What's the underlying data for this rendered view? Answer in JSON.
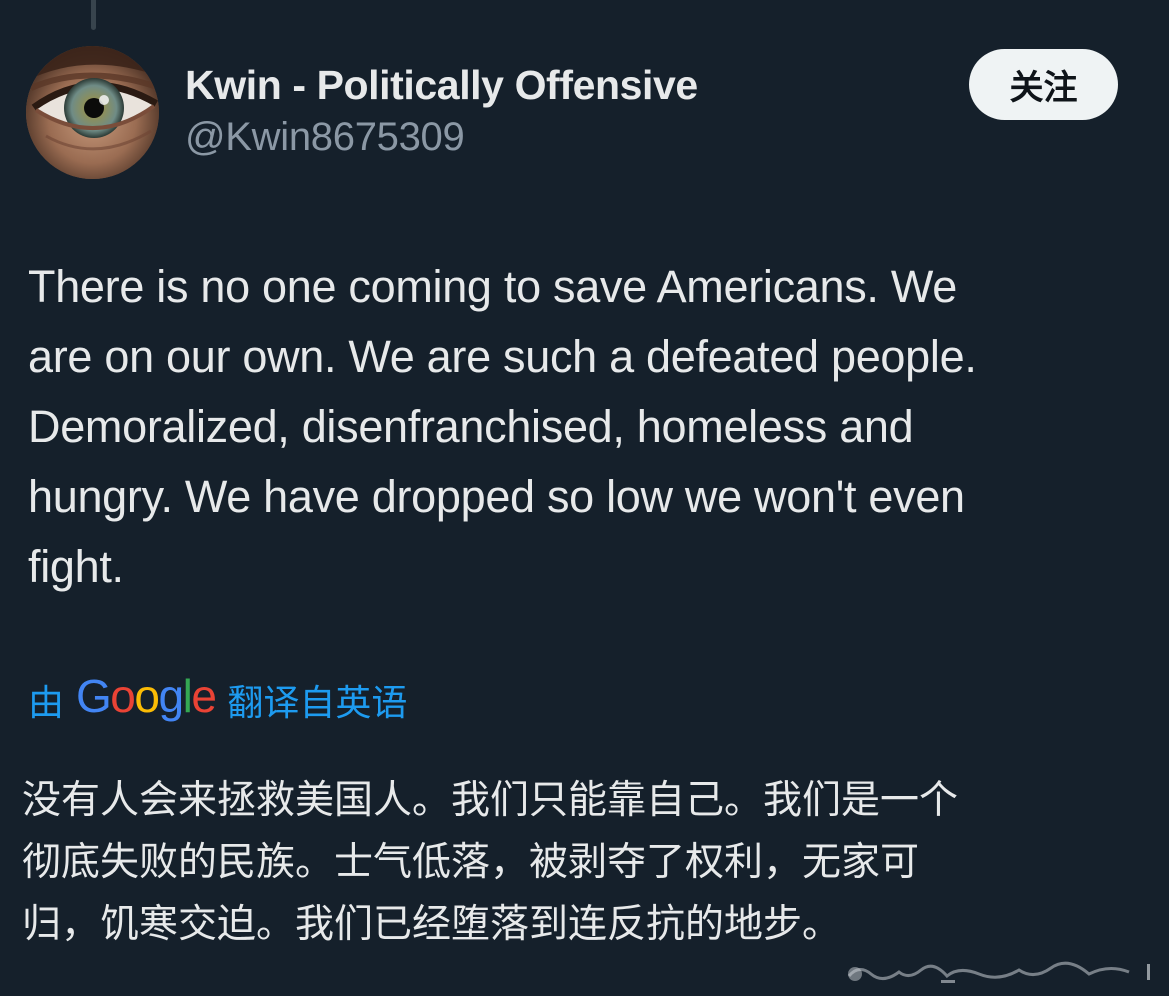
{
  "author": {
    "display_name": "Kwin - Politically Offensive",
    "handle": "@Kwin8675309"
  },
  "follow_button": {
    "label": "关注"
  },
  "tweet": {
    "lines": [
      "There is no one coming to save Americans. We",
      "are on our own. We are such a defeated people.",
      "Demoralized, disenfranchised, homeless and",
      "hungry. We have dropped so low we won't even",
      "fight."
    ]
  },
  "translation": {
    "prefix": "由",
    "provider_letters": [
      "G",
      "o",
      "o",
      "g",
      "l",
      "e"
    ],
    "suffix": "翻译自英语",
    "lines": [
      "没有人会来拯救美国人。我们只能靠自己。我们是一个",
      "彻底失败的民族。士气低落，被剥夺了权利，无家可",
      "归，饥寒交迫。我们已经堕落到连反抗的地步。"
    ]
  },
  "colors": {
    "background": "#15202b",
    "primary_text": "#e7e9ea",
    "secondary_text": "#8b98a5",
    "link_blue": "#1d9bf0",
    "follow_button_bg": "#eff3f4",
    "google_blue": "#4285f4",
    "google_red": "#ea4335",
    "google_yellow": "#fbbc05",
    "google_green": "#34a853"
  },
  "icons": {
    "avatar": "eye-closeup-avatar",
    "watermark": "handwritten-signature-watermark"
  }
}
